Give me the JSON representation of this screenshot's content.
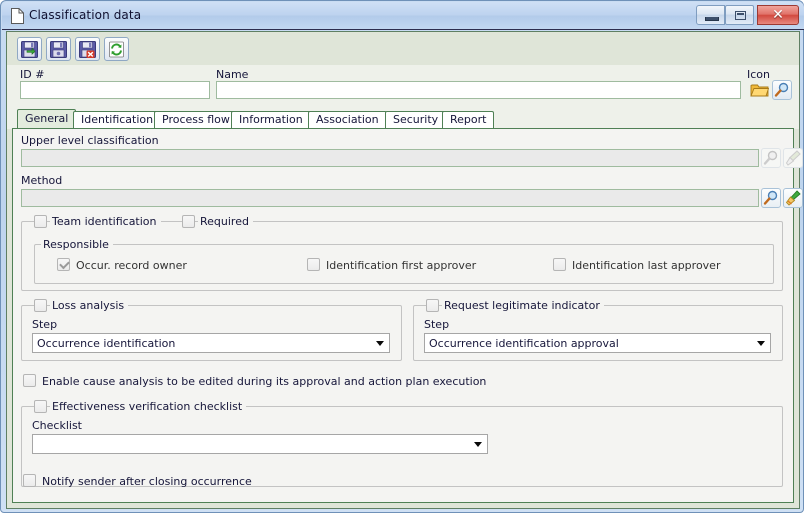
{
  "window": {
    "title": "Classification data",
    "title_icon": "document-icon",
    "controls": {
      "minimize": "minimize-icon",
      "maximize": "restore-icon",
      "close": "close-icon"
    }
  },
  "toolbar": {
    "buttons": [
      {
        "name": "save-and-continue-button",
        "icon": "floppy-disk-green-arrow-icon",
        "tooltip": "Save"
      },
      {
        "name": "save-button",
        "icon": "floppy-disk-icon",
        "tooltip": "Save and close"
      },
      {
        "name": "delete-button",
        "icon": "floppy-disk-red-x-icon",
        "tooltip": "Cancel"
      },
      {
        "name": "refresh-button",
        "icon": "refresh-green-arrows-icon",
        "tooltip": "Refresh"
      }
    ]
  },
  "header": {
    "id_label": "ID #",
    "id_value": "",
    "name_label": "Name",
    "name_value": "",
    "icon_label": "Icon",
    "folder_icon": "folder-icon",
    "search_icon": "magnifier-icon"
  },
  "tabs": [
    {
      "label": "General",
      "active": true
    },
    {
      "label": "Identification",
      "active": false
    },
    {
      "label": "Process flow",
      "active": false
    },
    {
      "label": "Information",
      "active": false
    },
    {
      "label": "Association",
      "active": false
    },
    {
      "label": "Security",
      "active": false
    },
    {
      "label": "Report",
      "active": false
    }
  ],
  "general": {
    "upper_level": {
      "label": "Upper level classification",
      "value": "",
      "search_icon": "magnifier-icon-disabled",
      "clear_icon": "broom-icon-disabled"
    },
    "method": {
      "label": "Method",
      "value": "",
      "search_icon": "magnifier-icon",
      "clear_icon": "broom-icon"
    },
    "team_identification": {
      "legend": "Team identification",
      "checked": false,
      "required_label": "Required",
      "required_checked": false,
      "responsible": {
        "legend": "Responsible",
        "items": [
          {
            "label": "Occur. record owner",
            "checked": true
          },
          {
            "label": "Identification first approver",
            "checked": false
          },
          {
            "label": "Identification last approver",
            "checked": false
          }
        ]
      }
    },
    "loss_analysis": {
      "legend": "Loss analysis",
      "checked": false,
      "step_label": "Step",
      "step_value": "Occurrence identification"
    },
    "request_legitimate_indicator": {
      "legend": "Request legitimate indicator",
      "checked": false,
      "step_label": "Step",
      "step_value": "Occurrence identification approval"
    },
    "enable_cause_analysis": {
      "label": "Enable cause analysis to be edited during its approval and action plan execution",
      "checked": false
    },
    "effectiveness_verification": {
      "legend": "Effectiveness verification checklist",
      "checked": false,
      "checklist_label": "Checklist",
      "checklist_value": ""
    },
    "notify_sender": {
      "label": "Notify sender after closing occurrence",
      "checked": false
    }
  },
  "colors": {
    "titlebar": "#b4cbea",
    "toolbar_bg": "#dfe5d8",
    "content_bg": "#f4f4f2",
    "tab_border": "#4f8055",
    "active_tab_bg": "#e3ecdd",
    "field_border": "#9fbb9f",
    "close_button": "#d2493f"
  }
}
